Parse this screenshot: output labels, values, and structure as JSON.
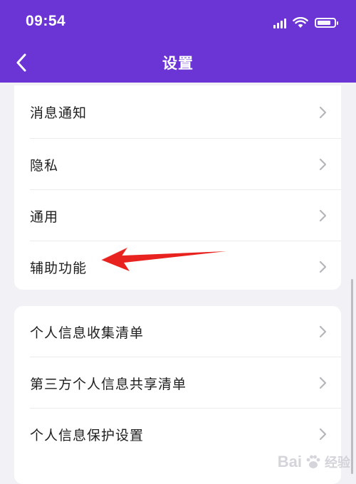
{
  "status_bar": {
    "time": "09:54",
    "icons": [
      "signal-icon",
      "wifi-icon",
      "battery-icon"
    ]
  },
  "nav": {
    "back_icon": "chevron-left-icon",
    "title": "设置"
  },
  "section1": {
    "items": [
      {
        "label": "消息通知"
      },
      {
        "label": "隐私"
      },
      {
        "label": "通用"
      },
      {
        "label": "辅助功能"
      }
    ]
  },
  "section2": {
    "items": [
      {
        "label": "个人信息收集清单"
      },
      {
        "label": "第三方个人信息共享清单"
      },
      {
        "label": "个人信息保护设置"
      }
    ]
  },
  "annotation": {
    "type": "red-arrow",
    "points_to": "辅助功能"
  },
  "watermark": {
    "brand": "Bai",
    "suffix": "经验"
  },
  "colors": {
    "header": "#6b35d6",
    "background": "#f2f2f6",
    "card": "#ffffff",
    "text": "#1e1e1e",
    "chevron": "#b5b5bb",
    "arrow": "#e8231f"
  }
}
